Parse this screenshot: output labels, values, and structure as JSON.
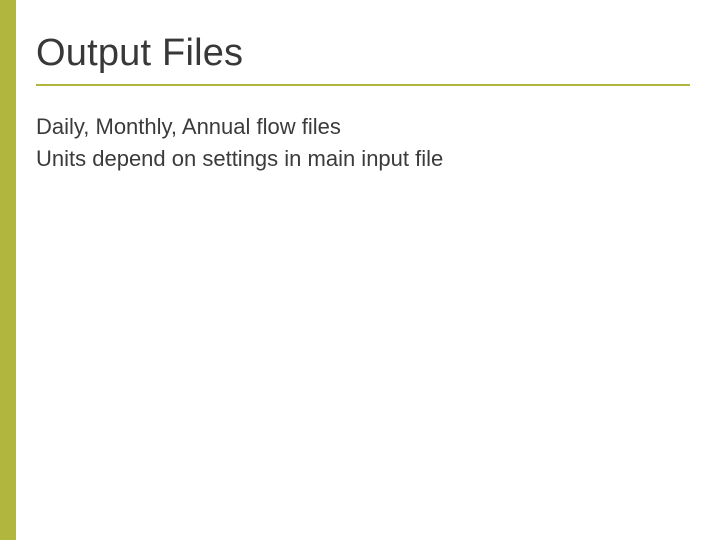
{
  "title": "Output Files",
  "bullets": [
    "Daily, Monthly, Annual flow files",
    "Units depend on settings in main input file"
  ],
  "colors": {
    "accent": "#b1b63f",
    "text": "#383838"
  }
}
